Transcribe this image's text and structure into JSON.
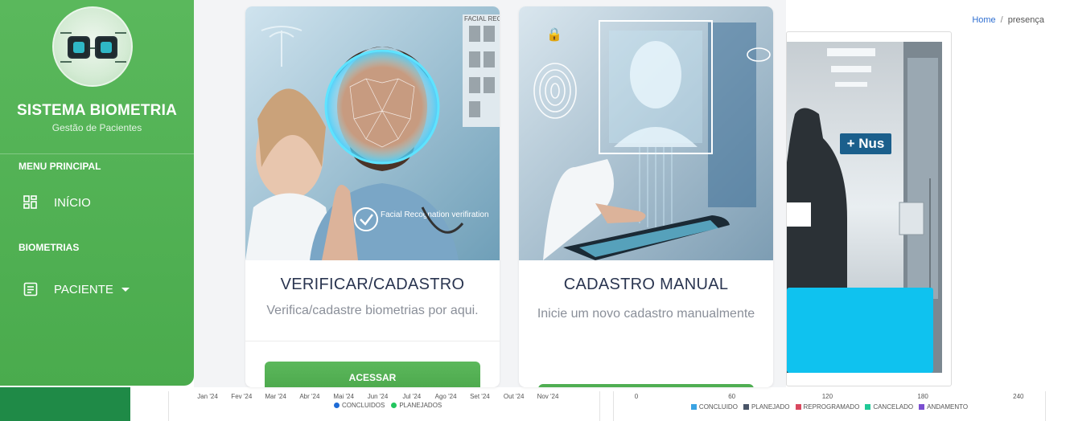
{
  "breadcrumb": {
    "home": "Home",
    "separator": "/",
    "current": "presença"
  },
  "sidebar": {
    "title": "SISTEMA BIOMETRIA",
    "subtitle": "Gestão de Pacientes",
    "sections": [
      {
        "label": "MENU PRINCIPAL",
        "items": [
          {
            "label": "INÍCIO",
            "icon": "dashboard-icon"
          }
        ]
      },
      {
        "label": "BIOMETRIAS",
        "items": [
          {
            "label": "PACIENTE",
            "icon": "list-icon",
            "has_dropdown": true
          }
        ]
      }
    ]
  },
  "cards": [
    {
      "title": "VERIFICAR/CADASTRO",
      "description": "Verifica/cadastre biometrias por aqui.",
      "button_label": "ACESSAR",
      "image_text": {
        "overlay_caption": "Facial Recognation verifiration",
        "panel_caption": "FACIAL RECE"
      }
    },
    {
      "title": "CADASTRO MANUAL",
      "description": "Inicie um novo cadastro manualmente",
      "button_label": ""
    }
  ],
  "side_image": {
    "sign_text": "+ Nus"
  },
  "colors": {
    "sidebar_green": "#4fae52",
    "accent_blue": "#0fc2ef",
    "title_text": "#2a3550",
    "button_green": "#5cb85c"
  },
  "charts": [
    {
      "chart_data": {
        "type": "line",
        "x": [
          "Jan '24",
          "Fev '24",
          "Mar '24",
          "Abr '24",
          "Mai '24",
          "Jun '24",
          "Jul '24",
          "Ago '24",
          "Set '24",
          "Out '24",
          "Nov '24"
        ],
        "series": [
          {
            "name": "CONCLUIDOS",
            "color": "#1e6bd6"
          },
          {
            "name": "PLANEJADOS",
            "color": "#22c55e"
          }
        ]
      }
    },
    {
      "chart_data": {
        "type": "bar",
        "x_ticks": [
          "0",
          "60",
          "120",
          "180",
          "240"
        ],
        "series": [
          {
            "name": "CONCLUIDO",
            "color": "#3aa3e3"
          },
          {
            "name": "PLANEJADO",
            "color": "#4a5568"
          },
          {
            "name": "REPROGRAMADO",
            "color": "#d9485f"
          },
          {
            "name": "CANCELADO",
            "color": "#20c997"
          },
          {
            "name": "ANDAMENTO",
            "color": "#7b4fd1"
          }
        ]
      }
    }
  ]
}
